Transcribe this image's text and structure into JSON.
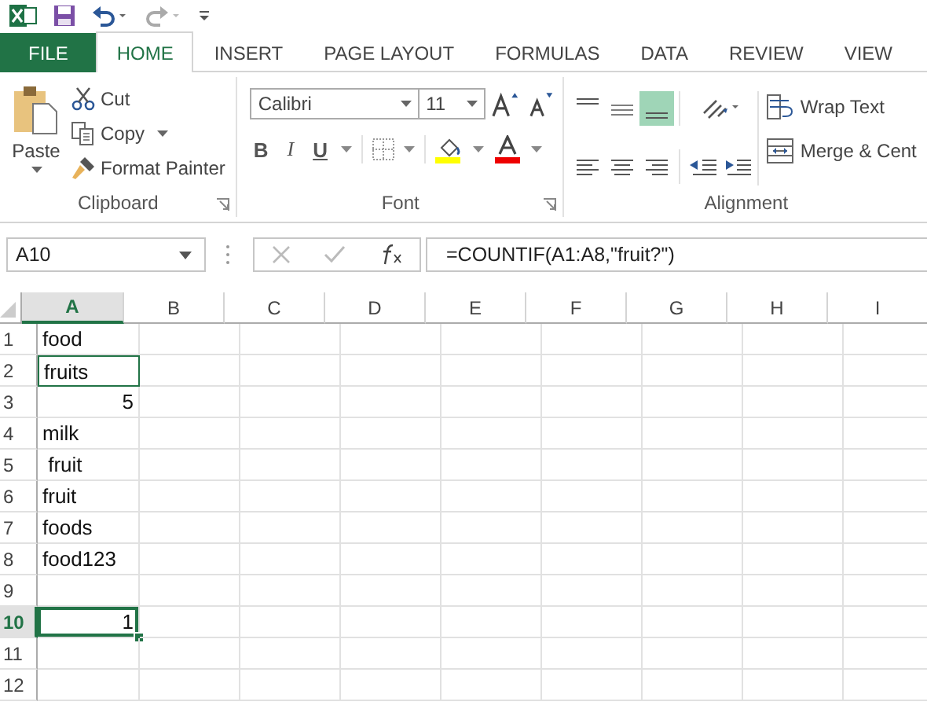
{
  "ribbon_tabs": [
    {
      "label": "FILE",
      "kind": "file",
      "selected": false
    },
    {
      "label": "HOME",
      "kind": "tab",
      "selected": true
    },
    {
      "label": "INSERT",
      "kind": "tab",
      "selected": false
    },
    {
      "label": "PAGE LAYOUT",
      "kind": "tab",
      "selected": false
    },
    {
      "label": "FORMULAS",
      "kind": "tab",
      "selected": false
    },
    {
      "label": "DATA",
      "kind": "tab",
      "selected": false
    },
    {
      "label": "REVIEW",
      "kind": "tab",
      "selected": false
    },
    {
      "label": "VIEW",
      "kind": "tab",
      "selected": false
    }
  ],
  "clipboard": {
    "paste": "Paste",
    "cut": "Cut",
    "copy": "Copy",
    "format_painter": "Format Painter",
    "label": "Clipboard"
  },
  "font": {
    "name": "Calibri",
    "size": "11",
    "bold": "B",
    "italic": "I",
    "underline": "U",
    "label": "Font"
  },
  "alignment": {
    "wrap_text": "Wrap Text",
    "merge": "Merge & Cent",
    "label": "Alignment",
    "bottom_align_on": true
  },
  "formula_bar": {
    "name_box": "A10",
    "formula": "=COUNTIF(A1:A8,\"fruit?\")"
  },
  "columns": [
    {
      "label": "A",
      "selected": true
    },
    {
      "label": "B",
      "selected": false
    },
    {
      "label": "C",
      "selected": false
    },
    {
      "label": "D",
      "selected": false
    },
    {
      "label": "E",
      "selected": false
    },
    {
      "label": "F",
      "selected": false
    },
    {
      "label": "G",
      "selected": false
    },
    {
      "label": "H",
      "selected": false
    },
    {
      "label": "I",
      "selected": false
    }
  ],
  "rows": [
    {
      "header": "1",
      "selected": false,
      "cell": {
        "text": "food",
        "kind": "text",
        "outlined": false
      }
    },
    {
      "header": "2",
      "selected": false,
      "cell": {
        "text": "fruits",
        "kind": "text",
        "outlined": true
      }
    },
    {
      "header": "3",
      "selected": false,
      "cell": {
        "text": "5",
        "kind": "number",
        "outlined": false
      }
    },
    {
      "header": "4",
      "selected": false,
      "cell": {
        "text": "milk",
        "kind": "text",
        "outlined": false
      }
    },
    {
      "header": "5",
      "selected": false,
      "cell": {
        "text": " fruit",
        "kind": "text",
        "outlined": false
      }
    },
    {
      "header": "6",
      "selected": false,
      "cell": {
        "text": "fruit",
        "kind": "text",
        "outlined": false
      }
    },
    {
      "header": "7",
      "selected": false,
      "cell": {
        "text": "foods",
        "kind": "text",
        "outlined": false
      }
    },
    {
      "header": "8",
      "selected": false,
      "cell": {
        "text": "food123",
        "kind": "text",
        "outlined": false
      }
    },
    {
      "header": "9",
      "selected": false,
      "cell": {
        "kind": "text",
        "outlined": false
      }
    },
    {
      "header": "10",
      "selected": true,
      "cell": {
        "text": "1",
        "kind": "number",
        "outlined": false
      }
    },
    {
      "header": "11",
      "selected": false,
      "cell": {
        "kind": "text",
        "outlined": false
      }
    },
    {
      "header": "12",
      "selected": false,
      "cell": {
        "kind": "text",
        "outlined": false
      }
    }
  ]
}
